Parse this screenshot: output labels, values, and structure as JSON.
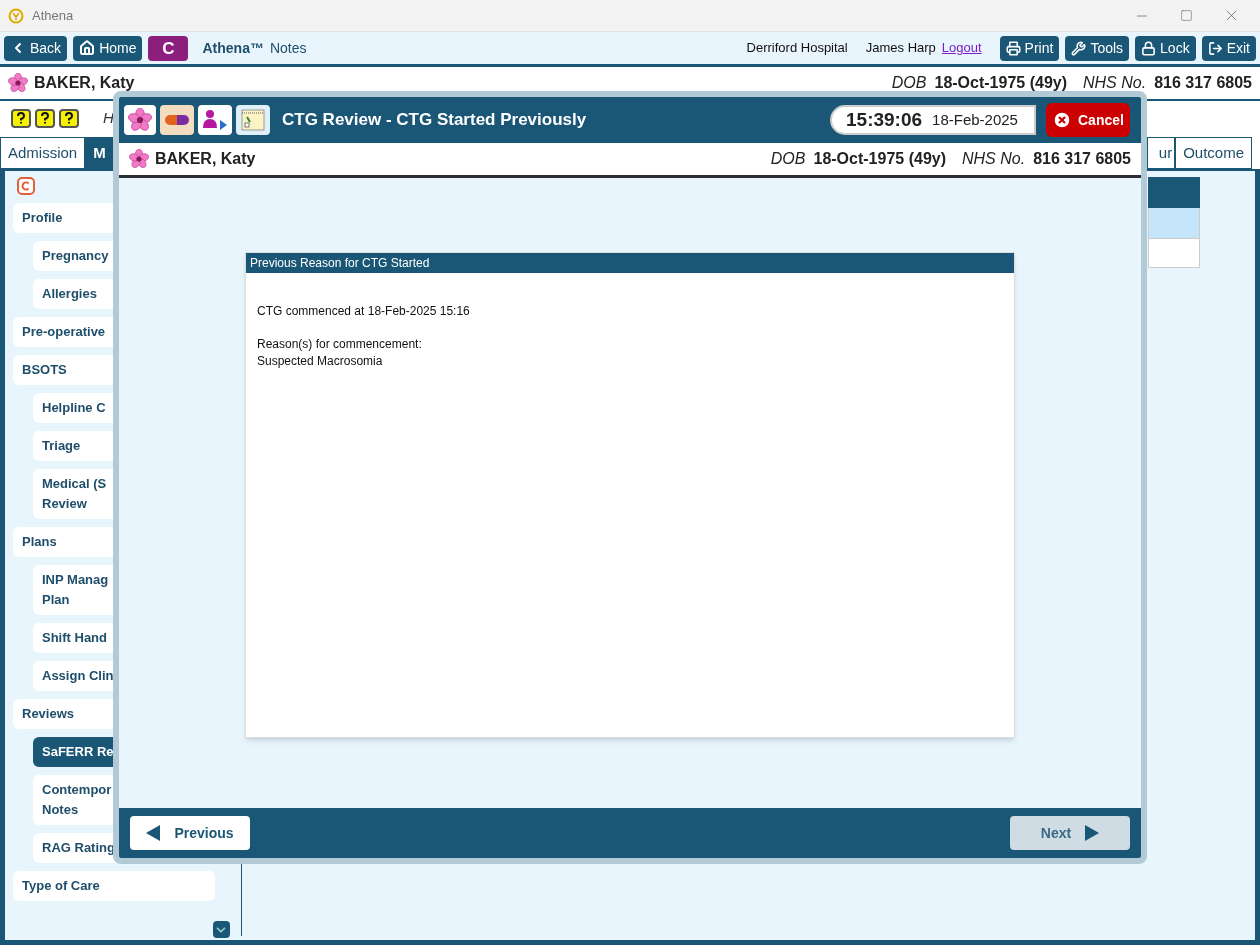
{
  "window": {
    "title": "Athena"
  },
  "toolbar": {
    "nav_buttons": [
      "Back",
      "Home"
    ],
    "app_badge": "C",
    "app_title": "Athena™",
    "app_subtitle": "Notes",
    "location": "Derriford Hospital",
    "user": "James Harp",
    "logout": "Logout",
    "action_buttons": [
      "Print",
      "Tools",
      "Lock",
      "Exit"
    ]
  },
  "patient": {
    "name": "BAKER, Katy",
    "dob_label": "DOB",
    "dob": "18-Oct-1975 (49y)",
    "nhs_label": "NHS No.",
    "nhs": "816 317 6805"
  },
  "help_text": "H",
  "tabs": [
    {
      "label": "Admission",
      "selected": false
    },
    {
      "label": "M",
      "selected": true
    },
    {
      "label": "ur",
      "selected": false
    },
    {
      "label": "Outcome",
      "selected": false
    }
  ],
  "sidebar": {
    "items": [
      {
        "lines": [
          "Profile"
        ],
        "selected": false,
        "children": [
          {
            "lines": [
              "Pregnancy"
            ],
            "selected": false
          },
          {
            "lines": [
              "Allergies"
            ],
            "selected": false
          }
        ]
      },
      {
        "lines": [
          "Pre-operative"
        ],
        "selected": false
      },
      {
        "lines": [
          "BSOTS"
        ],
        "selected": false,
        "children": [
          {
            "lines": [
              "Helpline C"
            ],
            "selected": false
          },
          {
            "lines": [
              "Triage"
            ],
            "selected": false
          },
          {
            "lines": [
              "Medical (S",
              "Review"
            ],
            "selected": false
          }
        ]
      },
      {
        "lines": [
          "Plans"
        ],
        "selected": false,
        "children": [
          {
            "lines": [
              "INP Manag",
              "Plan"
            ],
            "selected": false
          },
          {
            "lines": [
              "Shift Hand"
            ],
            "selected": false
          },
          {
            "lines": [
              "Assign Clin"
            ],
            "selected": false
          }
        ]
      },
      {
        "lines": [
          "Reviews"
        ],
        "selected": false,
        "children": [
          {
            "lines": [
              "SaFERR Re"
            ],
            "selected": true
          },
          {
            "lines": [
              "Contempor",
              "Notes"
            ],
            "selected": false
          },
          {
            "lines": [
              "RAG Rating"
            ],
            "selected": false
          }
        ]
      },
      {
        "lines": [
          "Type of Care"
        ],
        "selected": false
      }
    ]
  },
  "dialog": {
    "title": "CTG Review - CTG Started Previously",
    "time": "15:39:06",
    "date": "18-Feb-2025",
    "cancel": "Cancel",
    "patient": {
      "name": "BAKER, Katy",
      "dob_label": "DOB",
      "dob": "18-Oct-1975 (49y)",
      "nhs_label": "NHS No.",
      "nhs": "816 317 6805"
    },
    "card": {
      "title": "Previous Reason for CTG Started",
      "paragraphs": [
        [
          "CTG commenced at 18-Feb-2025 15:16"
        ],
        [
          "Reason(s) for commencement:",
          "Suspected Macrosomia"
        ]
      ]
    },
    "previous": {
      "label": "Previous",
      "disabled": false
    },
    "next": {
      "label": "Next",
      "disabled": true
    }
  }
}
